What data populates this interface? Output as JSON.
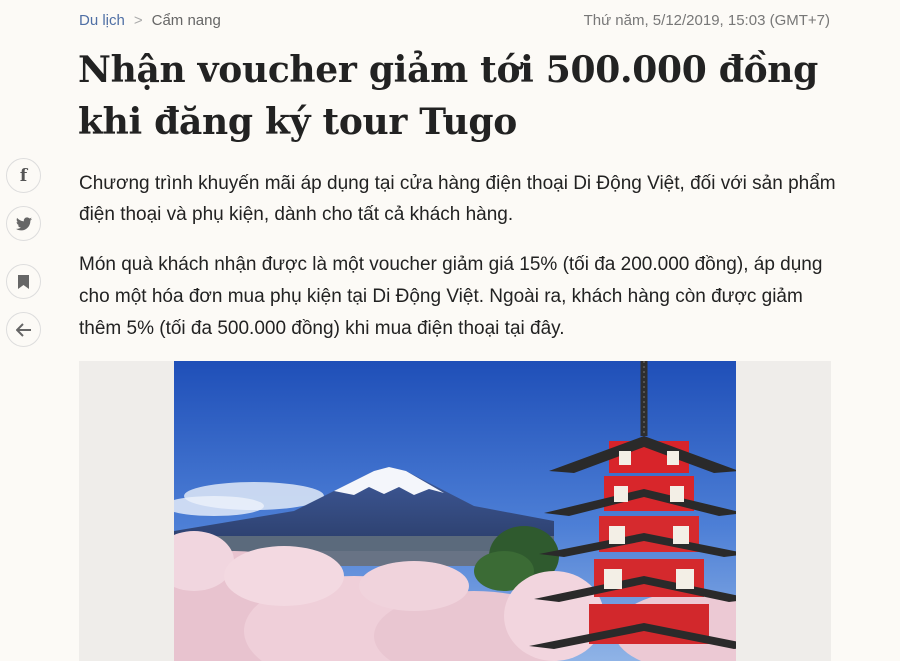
{
  "breadcrumb": {
    "category": "Du lịch",
    "subcategory": "Cẩm nang",
    "separator": ">"
  },
  "meta": {
    "timestamp": "Thứ năm, 5/12/2019, 15:03 (GMT+7)"
  },
  "article": {
    "title": "Nhận voucher giảm tới 500.000 đồng khi đăng ký tour Tugo",
    "lead": "Chương trình khuyến mãi áp dụng tại cửa hàng điện thoại Di Động Việt, đối với sản phẩm điện thoại và phụ kiện, dành cho tất cả khách hàng.",
    "paragraph": "Món quà khách nhận được là một voucher giảm giá 15% (tối đa 200.000 đồng), áp dụng cho một hóa đơn mua phụ kiện tại Di Động Việt. Ngoài ra, khách hàng còn được giảm thêm 5% (tối đa 500.000 đồng) khi mua điện thoại tại đây."
  },
  "share": {
    "icons": [
      "facebook-icon",
      "twitter-icon",
      "bookmark-icon",
      "back-arrow-icon"
    ]
  },
  "colors": {
    "background": "#fcfaf6",
    "category_link": "#4f6fa5",
    "text": "#222222"
  }
}
